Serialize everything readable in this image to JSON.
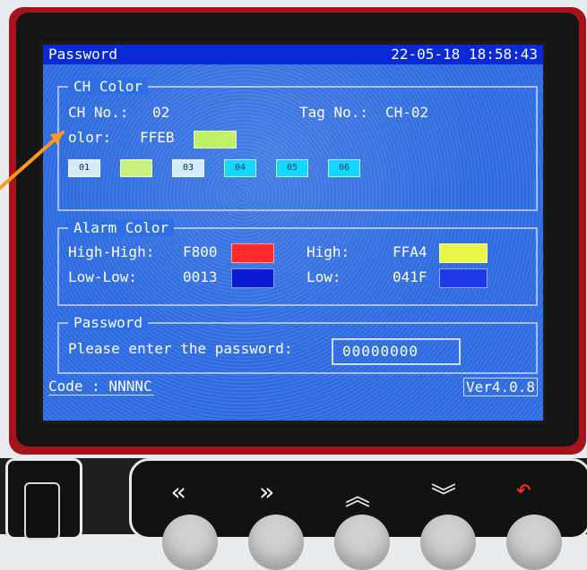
{
  "screen": {
    "title": "Password",
    "datetime": "22-05-18 18:58:43",
    "ch_color": {
      "legend": "CH Color",
      "ch_no_label": "CH No.:",
      "ch_no_value": "02",
      "tag_no_label": "Tag No.:",
      "tag_no_value": "CH-02",
      "color_label": "olor:",
      "color_value": "FFEB",
      "color_swatch_hex": "#bff06a",
      "chips": [
        {
          "label": "01",
          "style": "light"
        },
        {
          "label": "",
          "style": "yellowgreen"
        },
        {
          "label": "03",
          "style": "light"
        },
        {
          "label": "04",
          "style": "cyan"
        },
        {
          "label": "05",
          "style": "cyan"
        },
        {
          "label": "06",
          "style": "cyan"
        }
      ]
    },
    "alarm_color": {
      "legend": "Alarm Color",
      "high_high_label": "High-High:",
      "high_high_value": "F800",
      "high_high_hex": "#ff2b2b",
      "high_label": "High:",
      "high_value": "FFA4",
      "high_hex": "#e7f74a",
      "low_low_label": "Low-Low:",
      "low_low_value": "0013",
      "low_low_hex": "#0b1bd8",
      "low_label": "Low:",
      "low_value": "041F",
      "low_hex": "#1e39e8"
    },
    "password": {
      "legend": "Password",
      "prompt": "Please enter the password:",
      "value": "00000000"
    },
    "footer": {
      "code": "Code : NNNNC",
      "version": "Ver4.0.8"
    }
  },
  "hardware": {
    "buttons": [
      {
        "icon": "double-chevron-left-icon",
        "glyph": "«"
      },
      {
        "icon": "double-chevron-right-icon",
        "glyph": "»"
      },
      {
        "icon": "double-chevron-up-icon",
        "glyph": "︽"
      },
      {
        "icon": "double-chevron-down-icon",
        "glyph": "︾"
      },
      {
        "icon": "return-icon",
        "glyph": "↶",
        "color": "#ff2a2a"
      }
    ]
  }
}
